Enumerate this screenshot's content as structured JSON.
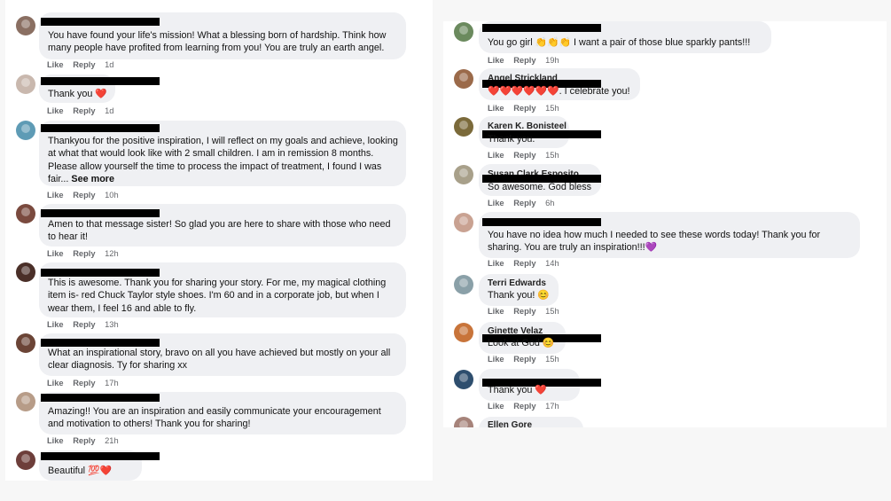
{
  "actions": {
    "like": "Like",
    "reply": "Reply"
  },
  "colors": {
    "bubble": "#eff0f3",
    "meta_text": "#65676b",
    "redaction": "#000000"
  },
  "left_comments": [
    {
      "author": "",
      "text": "You have found your life's mission! What a blessing born of hardship. Think how many people have profited from learning from you! You are truly an earth angel.",
      "time": "1d"
    },
    {
      "author": "",
      "text": "Thank you",
      "emoji": "❤️",
      "time": "1d"
    },
    {
      "author": "",
      "text": "Thankyou for the positive inspiration, I will reflect on my goals and achieve, looking at what that would look like with 2 small children. I am in remission 8 months. Please allow yourself the time to process the impact of treatment, I found I was fair...",
      "see_more": "See more",
      "time": "10h"
    },
    {
      "author": "",
      "text": "Amen to that message sister! So glad you are here to share with those who need to hear it!",
      "time": "12h"
    },
    {
      "author": "",
      "text": "This is awesome. Thank you for sharing your story. For me, my magical clothing item is- red Chuck Taylor style shoes. I'm 60 and in a corporate job, but when I wear them, I feel 16 and able to fly.",
      "time": "13h"
    },
    {
      "author": "",
      "text": "What an inspirational story, bravo on all you have achieved but mostly on your all clear diagnosis. Ty for sharing xx",
      "time": "17h"
    },
    {
      "author": "",
      "text": "Amazing!! You are an inspiration and easily communicate your encouragement and motivation to others! Thank you for sharing!",
      "time": "21h"
    },
    {
      "author": "",
      "text": "Beautiful",
      "emoji": "💯❤️",
      "time": ""
    }
  ],
  "right_comments": [
    {
      "author": "",
      "text": "You go girl",
      "emoji_mid": "👏👏👏",
      "text_after": "I want a pair of those blue sparkly pants!!!",
      "time": "19h"
    },
    {
      "author": "Angel Strickland",
      "emoji_pre": "❤️❤️❤️❤️❤️❤️",
      "text": ". I celebrate you!",
      "time": "15h"
    },
    {
      "author": "Karen K. Bonisteel",
      "text": "Thank you.",
      "time": "15h"
    },
    {
      "author": "Susan Clark Esposito",
      "text": "So awesome. God bless",
      "time": "6h"
    },
    {
      "author": "",
      "text": "You have no idea how much I needed to see these words today! Thank you for sharing. You are truly an inspiration!!!",
      "emoji": "💜",
      "time": "14h"
    },
    {
      "author": "Terri Edwards",
      "text": "Thank you!",
      "emoji": "😊",
      "time": "15h"
    },
    {
      "author": "Ginette Velaz",
      "text": "Look at God",
      "emoji": "😊",
      "time": "15h"
    },
    {
      "author": "",
      "text": "Thank you",
      "emoji": "❤️",
      "time": "17h"
    },
    {
      "author": "Ellen Gore",
      "text": "",
      "time": ""
    }
  ]
}
